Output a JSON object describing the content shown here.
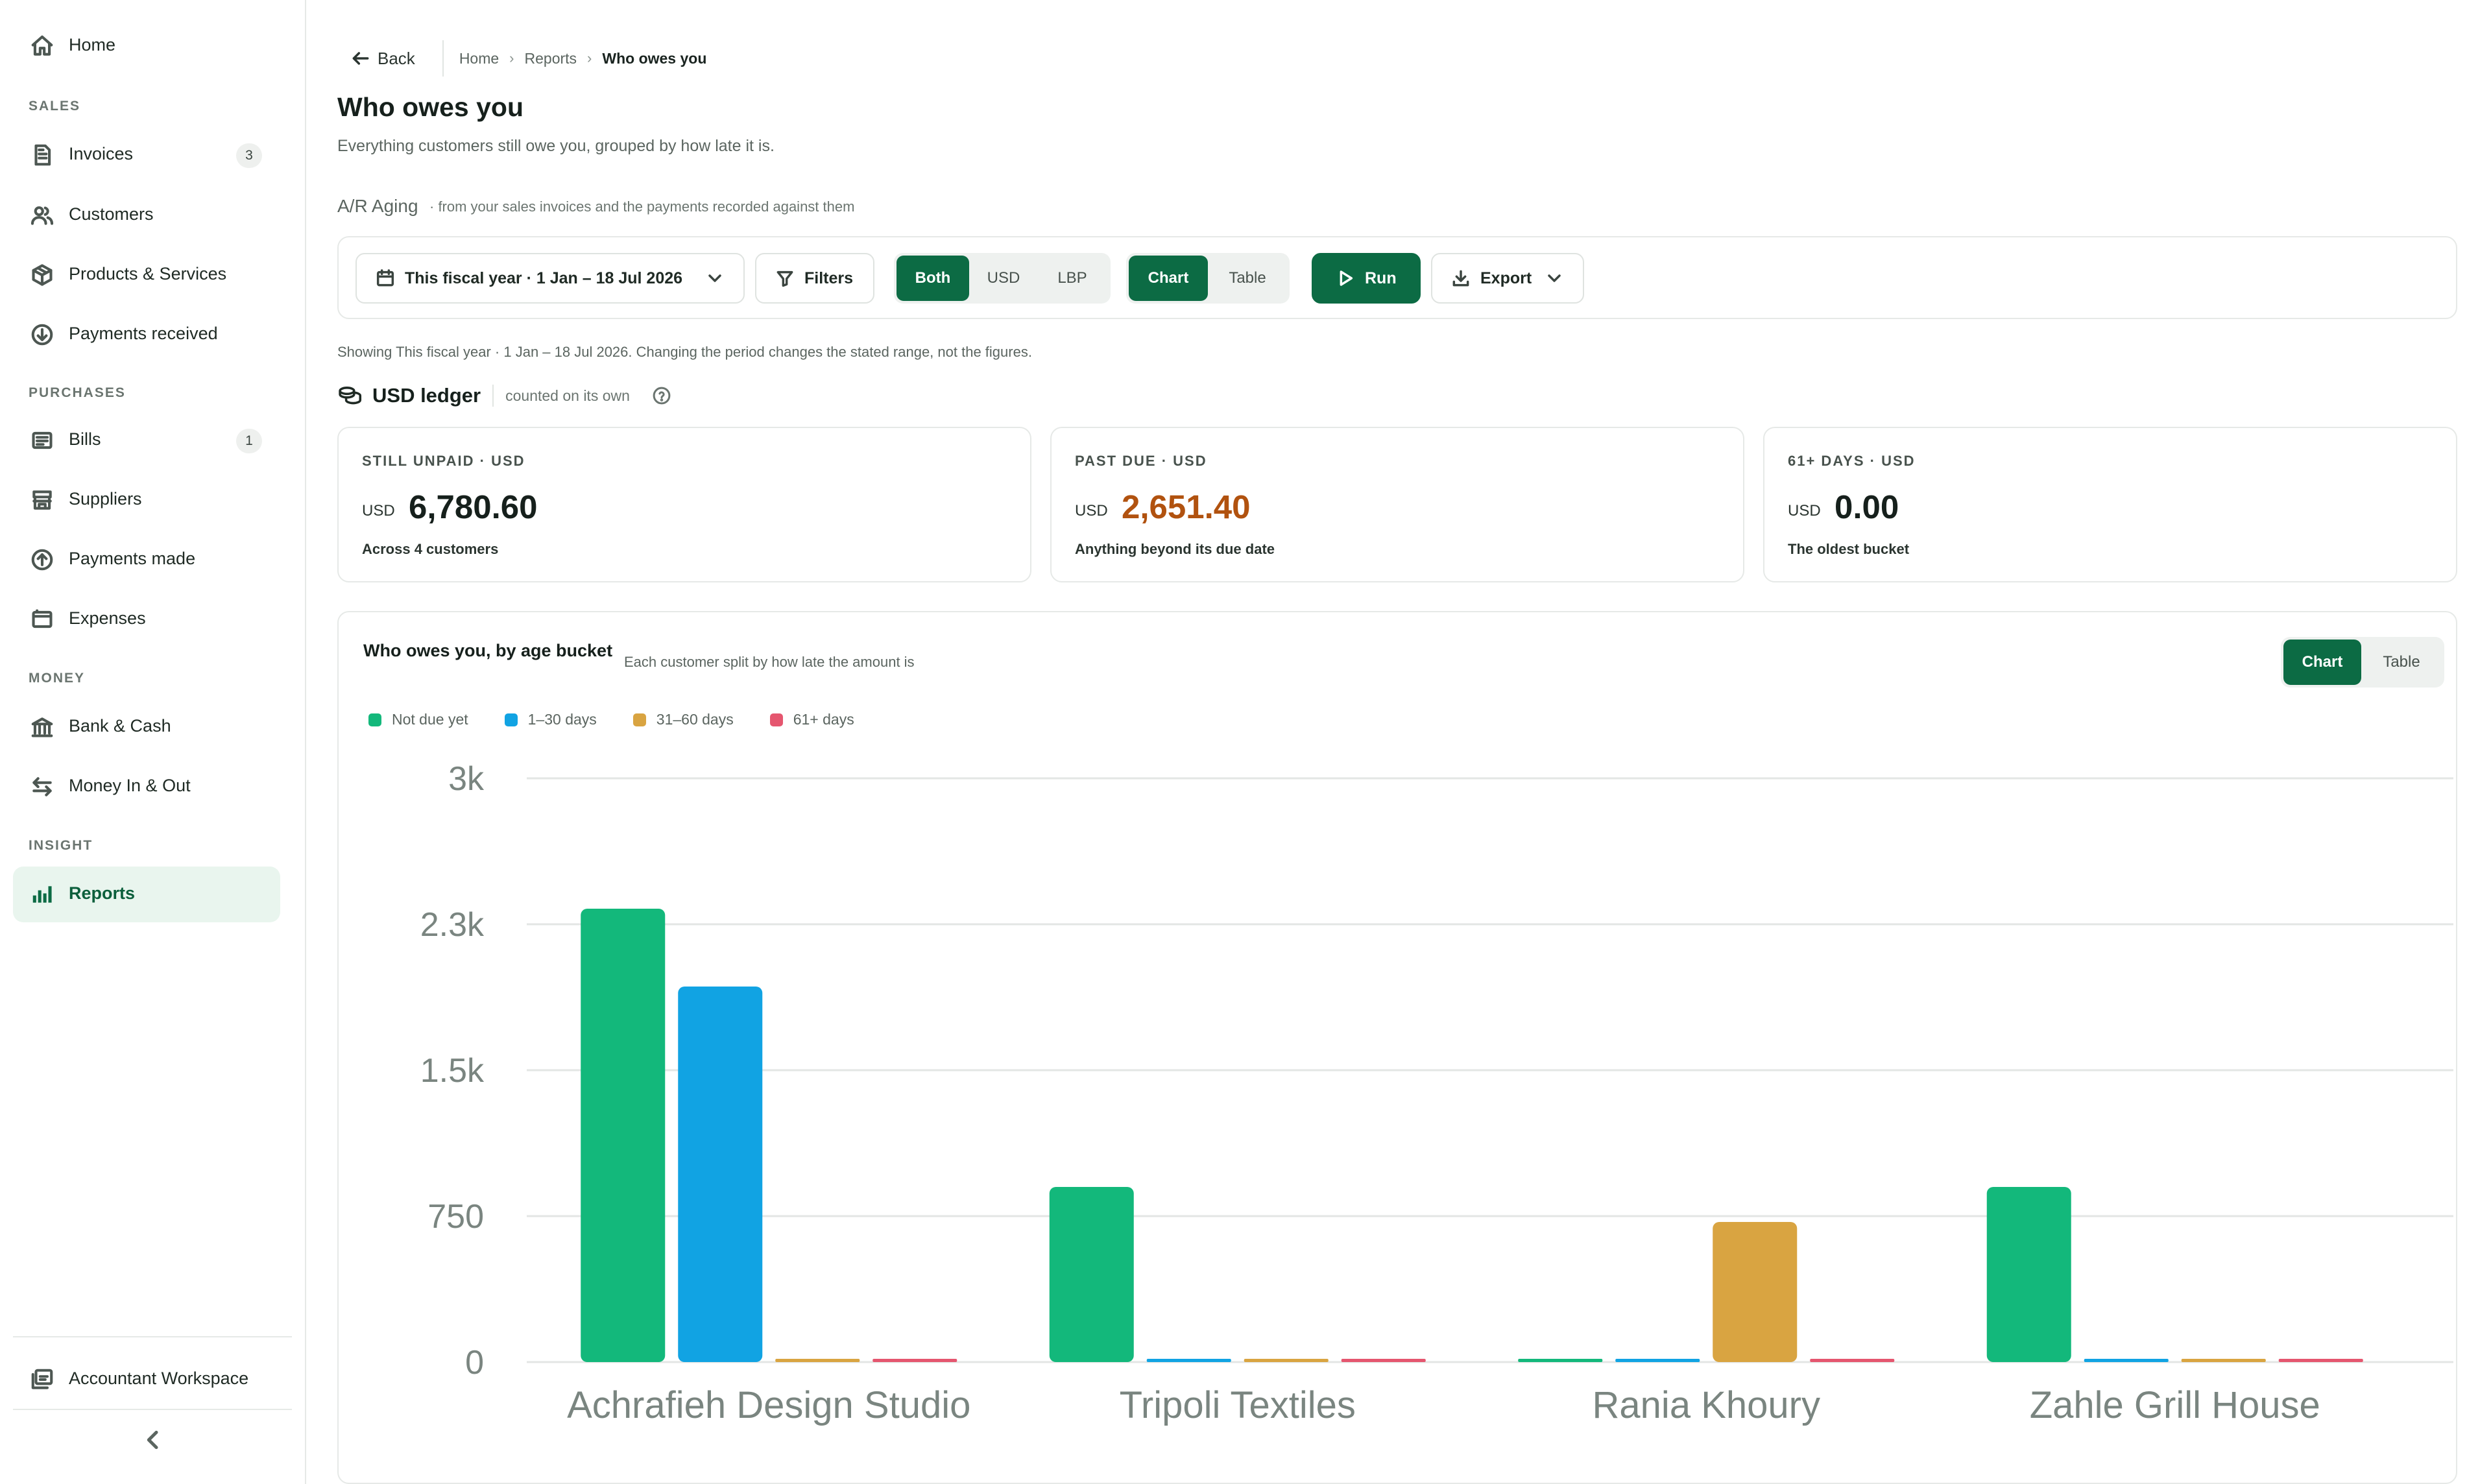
{
  "sidebar": {
    "home": "Home",
    "sections": {
      "sales": "SALES",
      "purchases": "PURCHASES",
      "money": "MONEY",
      "insight": "INSIGHT"
    },
    "items": {
      "invoices": {
        "label": "Invoices",
        "count": "3"
      },
      "customers": {
        "label": "Customers"
      },
      "products": {
        "label": "Products & Services"
      },
      "payments_received": {
        "label": "Payments received"
      },
      "bills": {
        "label": "Bills",
        "count": "1"
      },
      "suppliers": {
        "label": "Suppliers"
      },
      "payments_made": {
        "label": "Payments made"
      },
      "expenses": {
        "label": "Expenses"
      },
      "bank": {
        "label": "Bank & Cash"
      },
      "money_in_out": {
        "label": "Money In & Out"
      },
      "reports": {
        "label": "Reports"
      }
    },
    "workspace": "Accountant Workspace",
    "accent": "#0c6b44"
  },
  "breadcrumb": {
    "back": "Back",
    "home": "Home",
    "reports": "Reports",
    "current": "Who owes you"
  },
  "page": {
    "title": "Who owes you",
    "subtitle": "Everything customers still owe you, grouped by how late it is.",
    "report_name": "A/R Aging",
    "report_note": "· from your sales invoices and the payments recorded against them"
  },
  "toolbar": {
    "period": "This fiscal year · 1 Jan – 18 Jul 2026",
    "filters": "Filters",
    "currency_options": [
      "Both",
      "USD",
      "LBP"
    ],
    "currency_selected": "Both",
    "view_options": [
      "Chart",
      "Table"
    ],
    "view_selected": "Chart",
    "run": "Run",
    "export": "Export"
  },
  "showing": "Showing This fiscal year · 1 Jan – 18 Jul 2026. Changing the period changes the stated range, not the figures.",
  "ledger": {
    "title": "USD ledger",
    "note": "counted on its own"
  },
  "kpis": [
    {
      "label": "STILL UNPAID · USD",
      "currency": "USD",
      "value": "6,780.60",
      "sub": "Across 4 customers",
      "color": "#16201c"
    },
    {
      "label": "PAST DUE · USD",
      "currency": "USD",
      "value": "2,651.40",
      "sub": "Anything beyond its due date",
      "color": "#b1520f"
    },
    {
      "label": "61+ DAYS · USD",
      "currency": "USD",
      "value": "0.00",
      "sub": "The oldest bucket",
      "color": "#16201c"
    }
  ],
  "chart_card": {
    "title": "Who owes you, by age bucket",
    "subtitle": "Each customer split by how late the amount is",
    "toggle": [
      "Chart",
      "Table"
    ],
    "toggle_selected": "Chart"
  },
  "chart_data": {
    "type": "bar",
    "categories": [
      "Achrafieh Design Studio",
      "Tripoli Textiles",
      "Rania Khoury",
      "Zahle Grill House"
    ],
    "series": [
      {
        "name": "Not due yet",
        "color": "#13b87b",
        "values": [
          2330,
          900,
          0,
          900
        ]
      },
      {
        "name": "1–30 days",
        "color": "#11a3e3",
        "values": [
          1930,
          0,
          0,
          0
        ]
      },
      {
        "name": "31–60 days",
        "color": "#d9a441",
        "values": [
          0,
          0,
          720,
          0
        ]
      },
      {
        "name": "61+ days",
        "color": "#e5566f",
        "values": [
          0,
          0,
          0,
          0
        ]
      }
    ],
    "yticks": [
      "0",
      "750",
      "1.5k",
      "2.3k",
      "3k"
    ],
    "ylim": [
      0,
      3000
    ],
    "grid": true,
    "legend": "top-left"
  }
}
